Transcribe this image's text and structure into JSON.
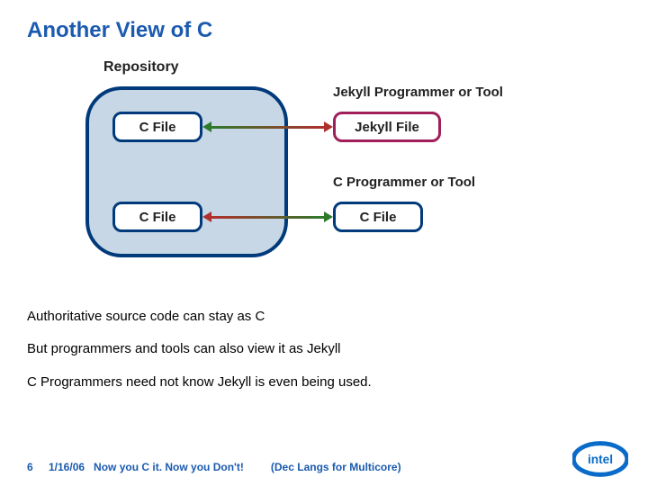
{
  "title": "Another View of C",
  "subhead": "Repository",
  "labels": {
    "jekyll_programmer": "Jekyll Programmer or Tool",
    "c_programmer": "C Programmer or Tool"
  },
  "boxes": {
    "repo_c_top": "C File",
    "repo_c_bottom": "C File",
    "jekyll_file": "Jekyll File",
    "c_file_right": "C File"
  },
  "body": {
    "p1": "Authoritative source code can stay as C",
    "p2": "But programmers and tools can also view it as Jekyll",
    "p3": "C Programmers need not know Jekyll is even being used."
  },
  "footer": {
    "page": "6",
    "date": "1/16/06",
    "tagline": "Now you C it. Now you Don't!",
    "desc": "(Dec Langs for Multicore)"
  },
  "brand": "intel"
}
